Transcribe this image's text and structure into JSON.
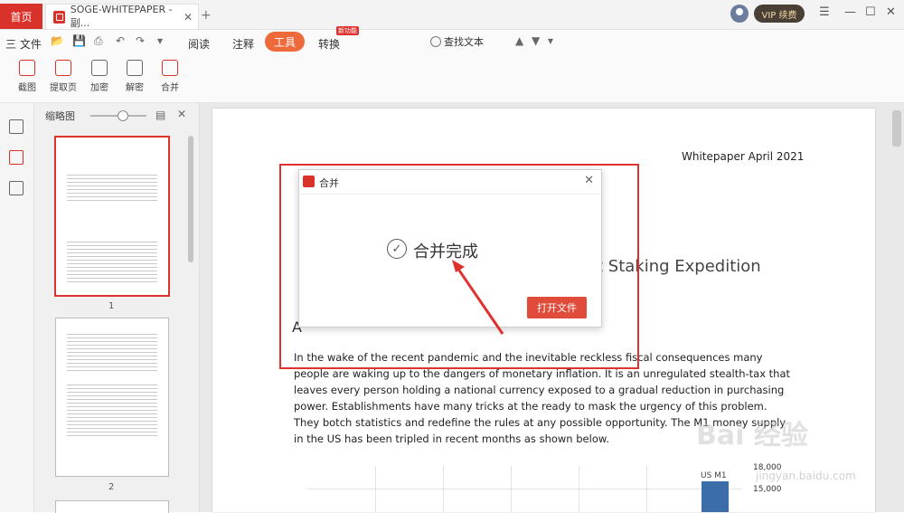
{
  "titlebar": {
    "home_tab": "首页",
    "doc_tab": "SOGE-WHITEPAPER - 副...",
    "vip_label": "VIP 续费",
    "close_symbol": "✕",
    "add_symbol": "+"
  },
  "menu": {
    "file": "三 文件",
    "items": [
      "阅读",
      "注释",
      "工具",
      "转换"
    ],
    "new_badge": "新功能",
    "search_label": "查找文本"
  },
  "ribbon": {
    "buttons": [
      "截图",
      "提取页",
      "加密",
      "解密",
      "合并"
    ]
  },
  "thumbs_panel": {
    "title": "缩略图",
    "page_numbers": [
      "1",
      "2"
    ]
  },
  "document": {
    "date": "Whitepaper April 2021",
    "heading": "t Staking Expedition",
    "section_letter": "A",
    "body": "In the wake of the recent pandemic and the inevitable reckless fiscal consequences many people are waking up to the dangers of monetary inflation. It is an unregulated stealth-tax that leaves every person holding a national currency exposed to a gradual reduction in purchasing power. Establishments have many tricks at the ready to mask the urgency of this problem. They botch statistics and redefine the rules at any possible opportunity. The M1 money supply in the US has been tripled in recent months as shown below.",
    "chart_label": "US M1",
    "y_axis_1": "18,000",
    "y_axis_2": "15,000"
  },
  "dialog": {
    "title": "合并",
    "message": "合并完成",
    "open_button": "打开文件"
  },
  "watermark": {
    "main": "Bai 经验",
    "sub": "jingyan.baidu.com"
  }
}
